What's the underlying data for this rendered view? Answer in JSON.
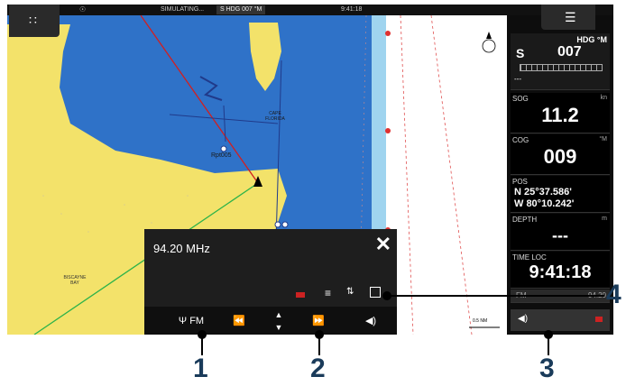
{
  "topbar": {
    "apps_icon": "grid-icon",
    "status": "SIMULATING...",
    "hdg_badge": "S HDG 007 °M",
    "clock": "9:41:18",
    "menu_icon": "hamburger-icon"
  },
  "chart": {
    "labels": [
      "CAPE FLORIDA",
      "Rpt005",
      "BISCAYNE BAY",
      "0.5 NM"
    ]
  },
  "instruments": {
    "hdg": {
      "label": "HDG °M",
      "prefix": "S",
      "value": "007",
      "sub": "---"
    },
    "sog": {
      "label": "SOG",
      "unit": "kn",
      "value": "11.2"
    },
    "cog": {
      "label": "COG",
      "unit": "°M",
      "value": "009"
    },
    "pos": {
      "label": "POS",
      "lat": "N  25°37.586'",
      "lon": "W  80°10.242'"
    },
    "depth": {
      "label": "DEPTH",
      "unit": "m",
      "value": "---"
    },
    "time": {
      "label": "TIME LOC",
      "value": "9:41:18"
    },
    "radio_line": {
      "band": "FM",
      "freq": "94.20"
    }
  },
  "radio": {
    "frequency": "94.20 MHz",
    "close_icon": "close-icon",
    "band_label": "FM",
    "icons": [
      "signal-icon",
      "list-icon",
      "equalizer-icon",
      "minimize-icon"
    ],
    "controls": [
      "rewind-icon",
      "tune-updown-icon",
      "fast-forward-icon",
      "volume-icon"
    ]
  },
  "callouts": [
    "1",
    "2",
    "3",
    "4"
  ]
}
